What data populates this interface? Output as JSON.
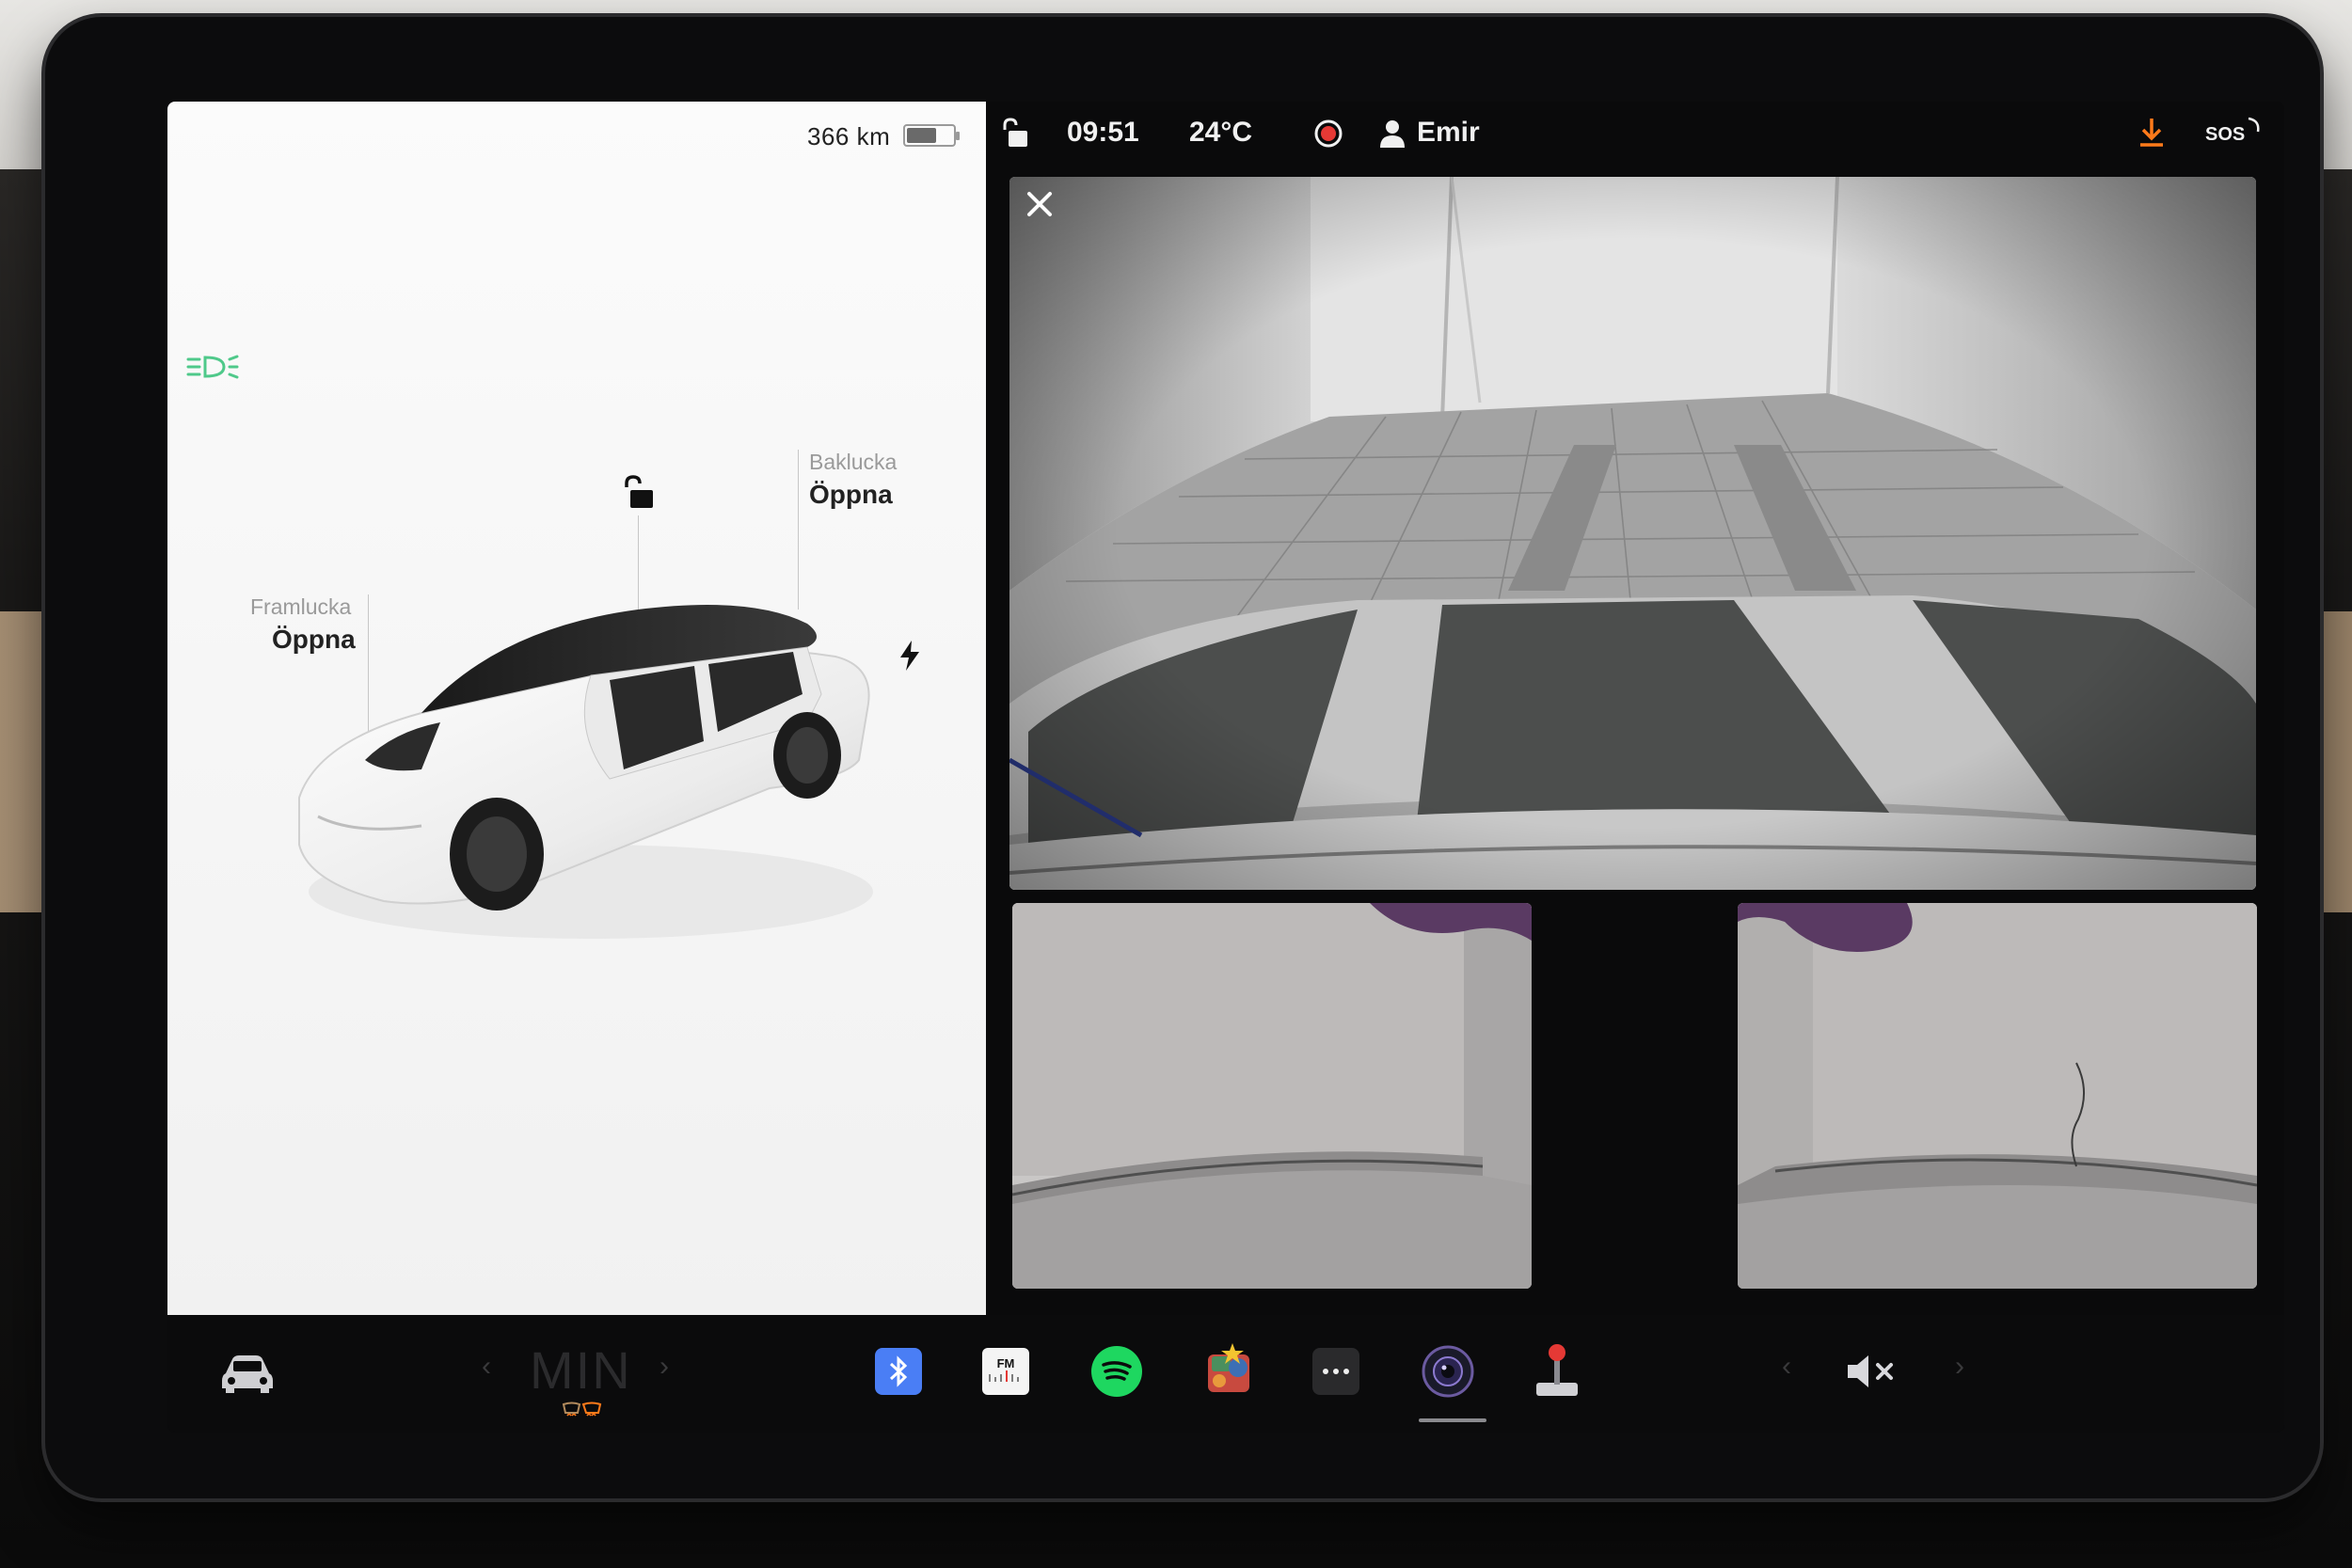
{
  "vehicle": {
    "range": "366 km",
    "battery_level": 0.65,
    "doors": {
      "rear": {
        "label": "Baklucka",
        "action": "Öppna"
      },
      "front": {
        "label": "Framlucka",
        "action": "Öppna"
      }
    }
  },
  "status_bar": {
    "time": "09:51",
    "temperature": "24°C",
    "user": "Emir",
    "sos": "SOS",
    "accent_orange": "#ff7a1a",
    "record_color": "#e53935"
  },
  "cameras": {
    "main": "rear-camera",
    "left": "left-repeater-camera",
    "right": "right-repeater-camera"
  },
  "dock": {
    "climate": "MIN",
    "apps": [
      "bluetooth",
      "fm-radio",
      "spotify",
      "toybox",
      "more",
      "camera",
      "joystick"
    ],
    "fm_label": "FM"
  }
}
